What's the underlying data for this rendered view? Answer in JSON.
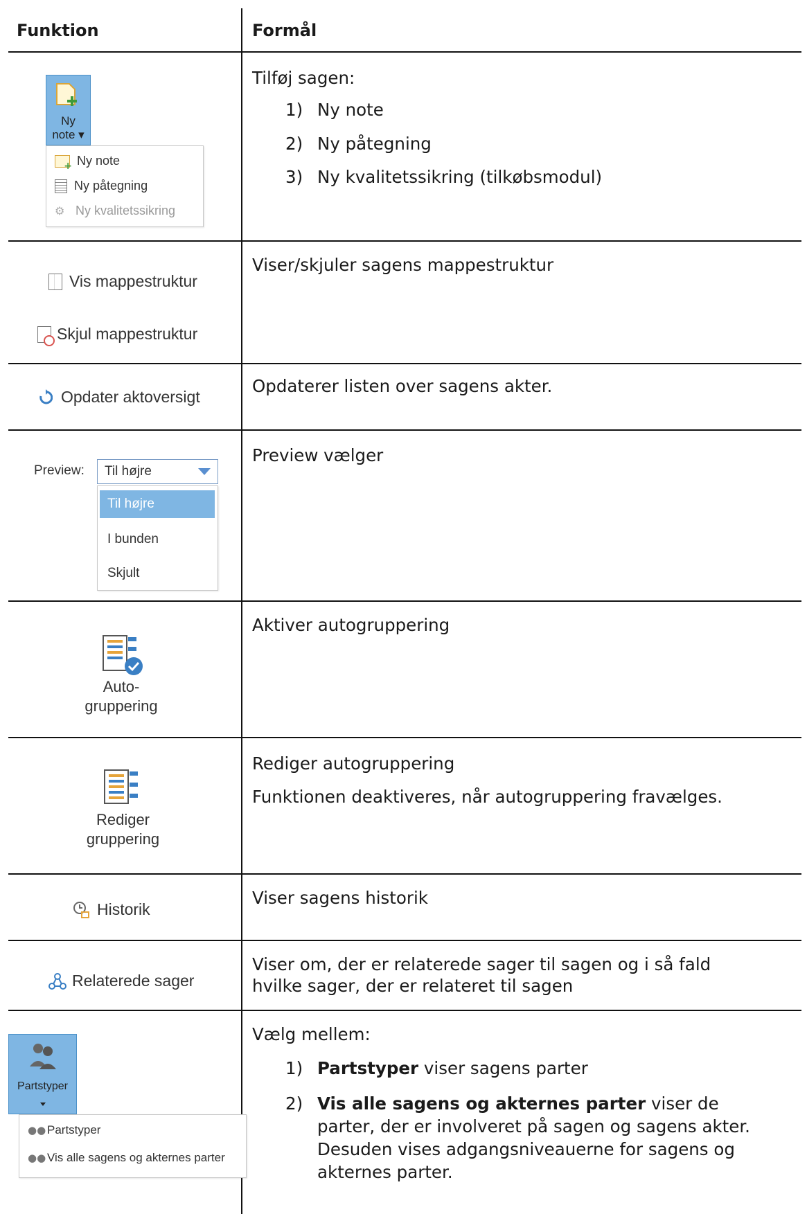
{
  "table": {
    "col1_header": "Funktion",
    "col2_header": "Formål"
  },
  "rows": {
    "ny_note": {
      "button_label_line1": "Ny",
      "button_label_line2": "note ▾",
      "menu": [
        "Ny note",
        "Ny påtegning",
        "Ny kvalitetssikring"
      ],
      "intro": "Tilføj sagen:",
      "items": [
        "Ny note",
        "Ny påtegning",
        "Ny kvalitetssikring (tilkøbsmodul)"
      ]
    },
    "mappestruktur": {
      "show_label": "Vis mappestruktur",
      "hide_label": "Skjul mappestruktur",
      "description": "Viser/skjuler sagens mappestruktur"
    },
    "opdater": {
      "label": "Opdater aktoversigt",
      "description": "Opdaterer listen over sagens akter."
    },
    "preview": {
      "label": "Preview:",
      "selected": "Til højre",
      "options": [
        "Til højre",
        "I bunden",
        "Skjult"
      ],
      "description": "Preview vælger"
    },
    "autogruppering": {
      "label_line1": "Auto-",
      "label_line2": "gruppering",
      "description": "Aktiver autogruppering"
    },
    "rediger": {
      "label_line1": "Rediger",
      "label_line2": "gruppering",
      "description1": "Rediger autogruppering",
      "description2": "Funktionen deaktiveres, når autogruppering fravælges."
    },
    "historik": {
      "label": "Historik",
      "description": "Viser sagens historik"
    },
    "relaterede": {
      "label": "Relaterede sager",
      "description_line1": "Viser om, der er relaterede sager til sagen og i så fald",
      "description_line2": "hvilke sager, der er relateret til sagen"
    },
    "partstyper": {
      "button_label": "Partstyper",
      "menu": [
        "Partstyper",
        "Vis alle sagens og akternes parter"
      ],
      "intro": "Vælg mellem:",
      "item1_bold": "Partstyper",
      "item1_rest": " viser sagens parter",
      "item2_bold": "Vis alle sagens og akternes parter",
      "item2_rest_line1": " viser de",
      "item2_rest_line2": "parter, der er involveret på sagen og sagens akter.",
      "item2_rest_line3": "Desuden vises adgangsniveauerne for sagens og",
      "item2_rest_line4": "akternes parter."
    }
  },
  "colors": {
    "ribbon_blue": "#7fb6e3",
    "selected_blue": "#7fb6e3",
    "rule": "#111111",
    "refresh_blue": "#3a7fc4"
  }
}
